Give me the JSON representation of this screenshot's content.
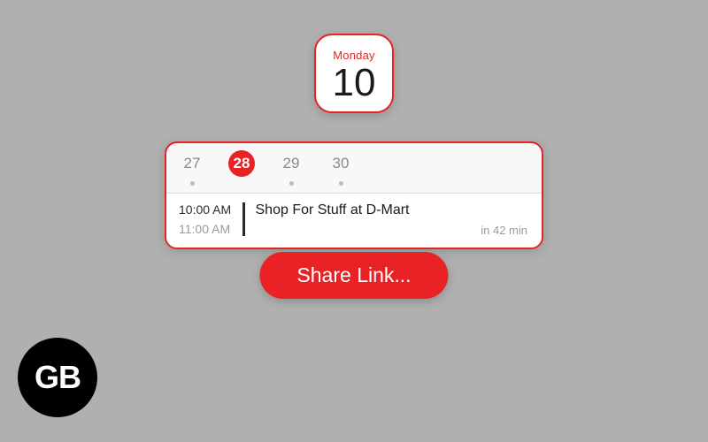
{
  "icon": {
    "day_name": "Monday",
    "day_number": "10"
  },
  "dates": [
    {
      "num": "27",
      "selected": false,
      "dot": true
    },
    {
      "num": "28",
      "selected": true,
      "dot": false
    },
    {
      "num": "29",
      "selected": false,
      "dot": true
    },
    {
      "num": "30",
      "selected": false,
      "dot": true
    }
  ],
  "event": {
    "start": "10:00 AM",
    "end": "11:00 AM",
    "title": "Shop For Stuff at D-Mart",
    "eta": "in 42 min"
  },
  "share_button": "Share Link...",
  "logo": "GB",
  "accent": "#e92226"
}
